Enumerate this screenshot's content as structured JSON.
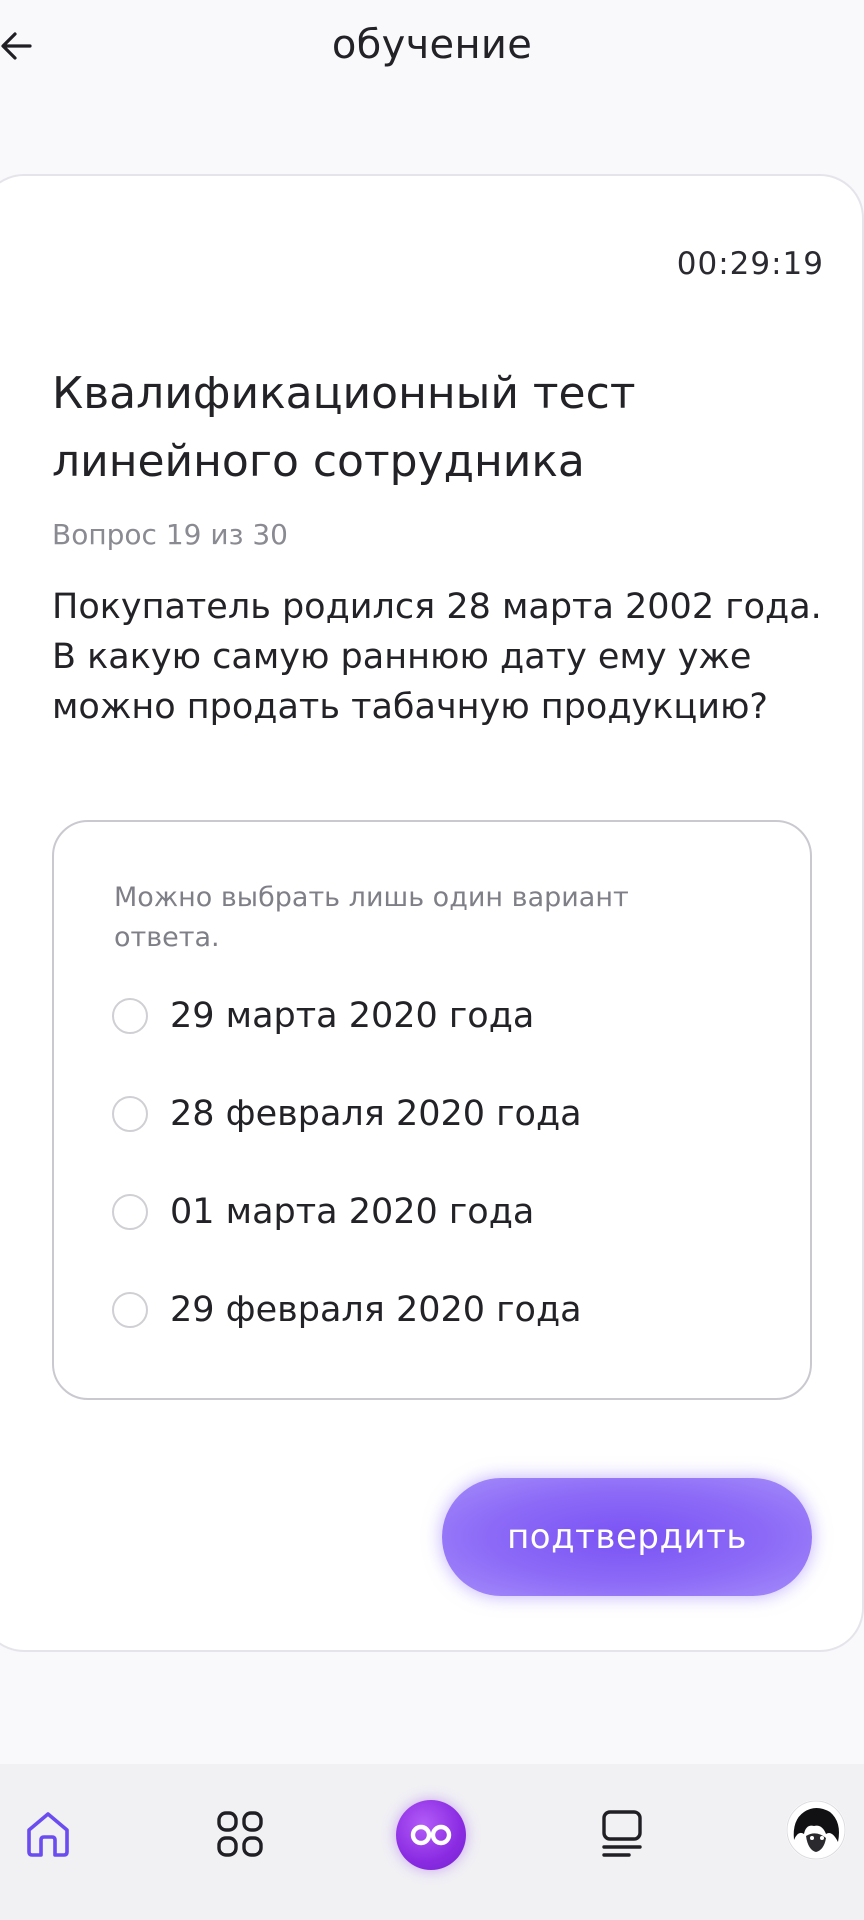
{
  "header": {
    "title": "обучение",
    "back_icon": "arrow-left-icon"
  },
  "test": {
    "timer": "00:29:19",
    "title": "Квалификационный тест линейного сотрудника",
    "counter": "Вопрос 19 из 30",
    "question": "Покупатель родился 28 марта 2002 года. В какую самую раннюю дату ему уже можно продать табачную продукцию?",
    "hint": "Можно выбрать лишь один вариант ответа.",
    "options": [
      {
        "label": "29 марта 2020 года",
        "selected": false
      },
      {
        "label": "28 февраля 2020 года",
        "selected": false
      },
      {
        "label": "01 марта 2020 года",
        "selected": false
      },
      {
        "label": "29 февраля 2020 года",
        "selected": false
      }
    ],
    "confirm_label": "подтвердить"
  },
  "colors": {
    "accent": "#8a6cf7",
    "nav_active": "#6a4cf0",
    "center_button": "#8a2be2"
  },
  "bottom_nav": {
    "items": [
      {
        "icon": "home-icon",
        "active": true
      },
      {
        "icon": "grid-icon",
        "active": false
      },
      {
        "icon": "infinity-icon",
        "active": false
      },
      {
        "icon": "list-icon",
        "active": false
      },
      {
        "icon": "avatar",
        "active": false
      }
    ]
  }
}
